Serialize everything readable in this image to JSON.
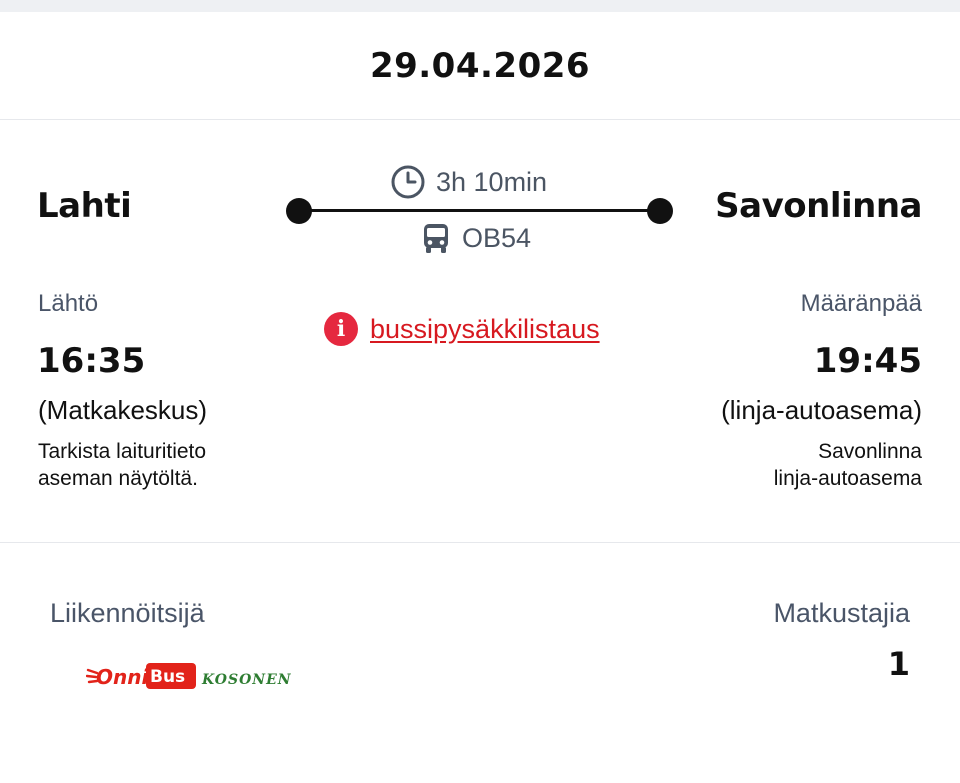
{
  "trip": {
    "date": "29.04.2026",
    "origin": "Lahti",
    "destination": "Savonlinna",
    "duration": "3h 10min",
    "line_code": "OB54"
  },
  "departure": {
    "label": "Lähtö",
    "time": "16:35",
    "station": "(Matkakeskus)",
    "note_line1": "Tarkista laituritieto",
    "note_line2": "aseman näytöltä."
  },
  "arrival": {
    "label": "Määränpää",
    "time": "19:45",
    "station": "(linja-autoasema)",
    "note_line1": "Savonlinna",
    "note_line2": "linja-autoasema"
  },
  "info_link": {
    "text": "bussipysäkkilistaus",
    "icon": "info-icon"
  },
  "details": {
    "operator_label": "Liikennöitsijä",
    "operator_logo": {
      "brand_main": "Onni",
      "brand_bus": "Bus",
      "brand_sub": "KOSONEN"
    },
    "passengers_label": "Matkustajia",
    "passengers_count": "1"
  },
  "colors": {
    "link_red": "#d71920",
    "info_red": "#e5283f",
    "muted_text": "#4a5568",
    "logo_green": "#2e7d32"
  },
  "icons": [
    "clock-icon",
    "bus-icon",
    "info-icon"
  ]
}
